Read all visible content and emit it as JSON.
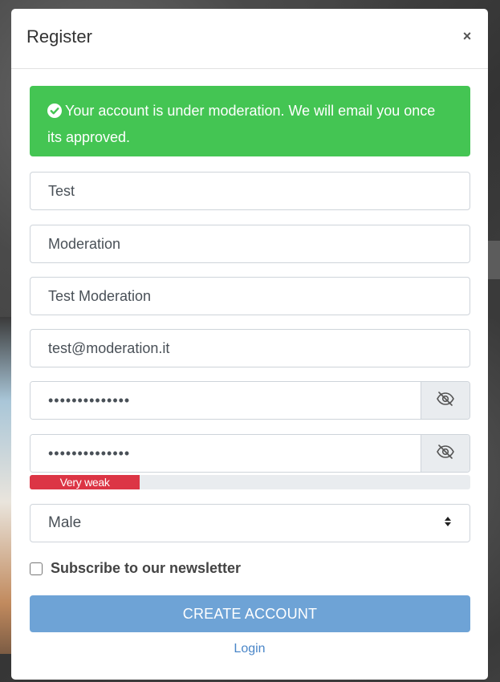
{
  "modal": {
    "title": "Register",
    "close_label": "×"
  },
  "alert": {
    "message": "Your account is under moderation. We will email you once its approved.",
    "color": "#44c553"
  },
  "form": {
    "first_name": "Test",
    "last_name": "Moderation",
    "display_name": "Test Moderation",
    "email": "test@moderation.it",
    "password": "••••••••••••••",
    "password_confirm": "••••••••••••••",
    "password_toggle_icon": "eye-slash-icon",
    "strength": {
      "label": "Very weak",
      "percent": 25,
      "color": "#dc3545"
    },
    "gender": {
      "selected": "Male"
    },
    "newsletter": {
      "label": "Subscribe to our newsletter",
      "checked": false
    },
    "submit_label": "CREATE ACCOUNT",
    "login_label": "Login"
  },
  "colors": {
    "primary_button": "#6ea3d6",
    "link": "#4a86c8"
  }
}
